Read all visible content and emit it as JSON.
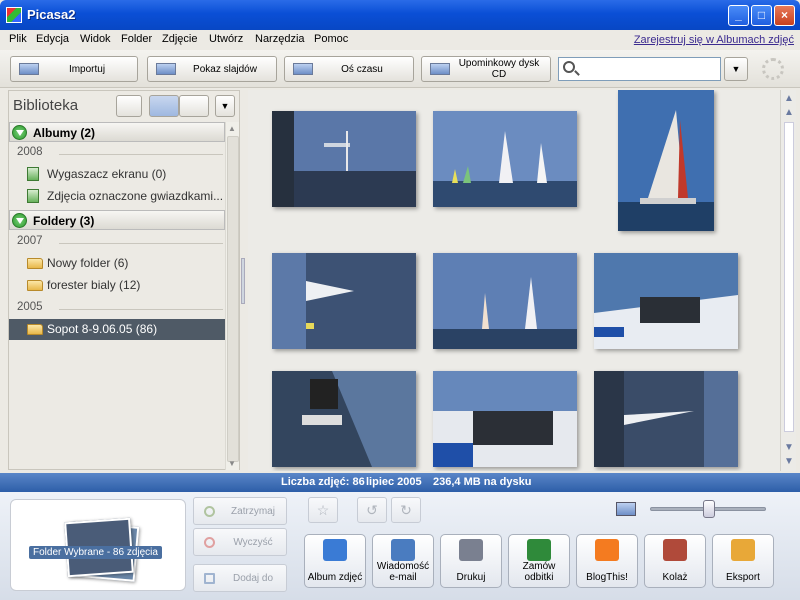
{
  "window": {
    "title": "Picasa2",
    "minimize": "_",
    "maximize": "□",
    "close": "×"
  },
  "menu": {
    "items": [
      "Plik",
      "Edycja",
      "Widok",
      "Folder",
      "Zdjęcie",
      "Utwórz",
      "Narzędzia",
      "Pomoc"
    ],
    "register_link": "Zarejestruj się w Albumach zdjęć"
  },
  "toolbar": {
    "import": "Importuj",
    "slideshow": "Pokaz slajdów",
    "timeline": "Oś czasu",
    "giftcd": "Upominkowy dysk CD",
    "search_value": "",
    "search_dropdown": "▼"
  },
  "library": {
    "title": "Biblioteka",
    "albums_header": "Albumy (2)",
    "albums_year": "2008",
    "albums": [
      "Wygaszacz ekranu (0)",
      "Zdjęcia oznaczone gwiazdkami..."
    ],
    "folders_header": "Foldery (3)",
    "folders_year1": "2007",
    "folders1": [
      "Nowy folder (6)",
      "forester bialy (12)"
    ],
    "folders_year2": "2005",
    "folders2": [
      "Sopot 8-9.06.05 (86)"
    ]
  },
  "status": {
    "count": "Liczba zdjęć: 86",
    "date": "lipiec 2005",
    "size": "236,4 MB na dysku"
  },
  "tray": {
    "label": "Folder Wybrane - 86 zdjęcia",
    "hold": "Zatrzymaj",
    "clear": "Wyczyść",
    "add_to": "Dodaj do"
  },
  "zoom": {
    "level": 0.5
  },
  "actions": [
    {
      "label": "Album zdjęć",
      "icon": "picasa-web-icon",
      "color": "#3a7bd5"
    },
    {
      "label": "Wiadomość e-mail",
      "icon": "email-icon",
      "color": "#4a7cc0"
    },
    {
      "label": "Drukuj",
      "icon": "printer-icon",
      "color": "#7a8090"
    },
    {
      "label": "Zamów odbitki",
      "icon": "globe-icon",
      "color": "#2f8a3a"
    },
    {
      "label": "BlogThis!",
      "icon": "blogger-icon",
      "color": "#f47b20"
    },
    {
      "label": "Kolaż",
      "icon": "collage-icon",
      "color": "#b04a3a"
    },
    {
      "label": "Eksport",
      "icon": "folder-export-icon",
      "color": "#e8a838"
    }
  ]
}
